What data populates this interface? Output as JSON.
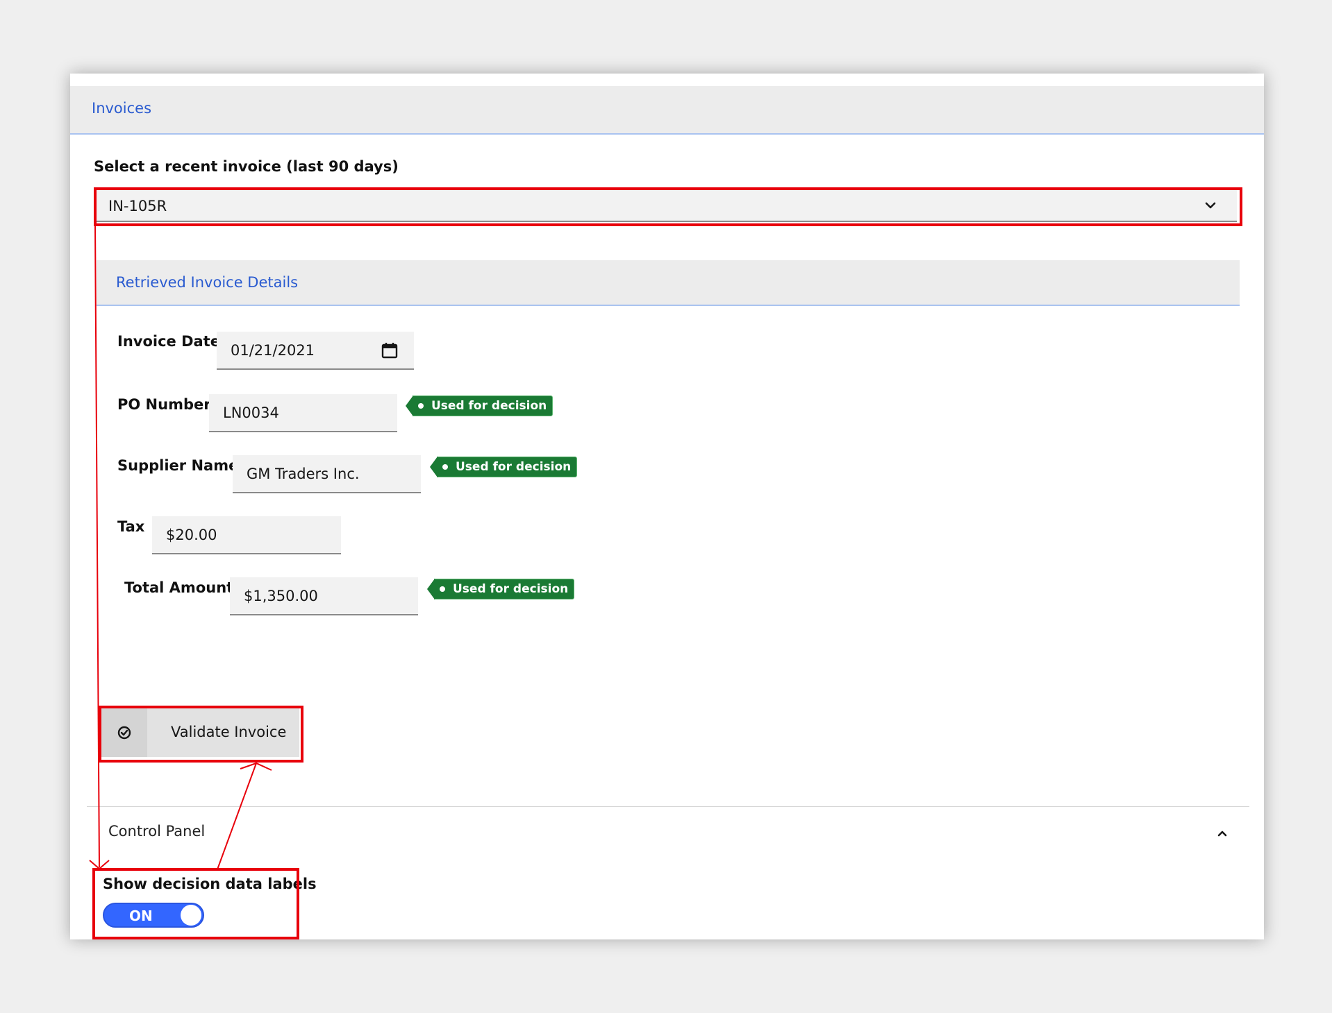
{
  "tabs": [
    {
      "label": "Invoices"
    }
  ],
  "invoice_select": {
    "label": "Select a recent invoice (last 90 days)",
    "value": "IN-105R"
  },
  "details": {
    "title": "Retrieved Invoice Details",
    "fields": {
      "invoice_date": {
        "label": "Invoice Date",
        "value": "01/21/2021"
      },
      "po_number": {
        "label": "PO Number",
        "value": "LN0034",
        "tag": "Used for decision"
      },
      "supplier_name": {
        "label": "Supplier Name",
        "value": "GM Traders Inc.",
        "tag": "Used for decision"
      },
      "tax": {
        "label": "Tax",
        "value": "$20.00"
      },
      "total_amount": {
        "label": "Total Amount",
        "value": "$1,350.00",
        "tag": "Used for decision"
      }
    }
  },
  "validate_button": {
    "label": "Validate Invoice",
    "icon": "check-circle-icon"
  },
  "control_panel": {
    "title": "Control Panel",
    "toggle_label": "Show decision data labels",
    "toggle_state": "ON"
  },
  "colors": {
    "accent": "#2a5bd0",
    "tag_green": "#1a7a34",
    "toggle_blue": "#3366ff",
    "highlight_red": "#e8000b"
  }
}
